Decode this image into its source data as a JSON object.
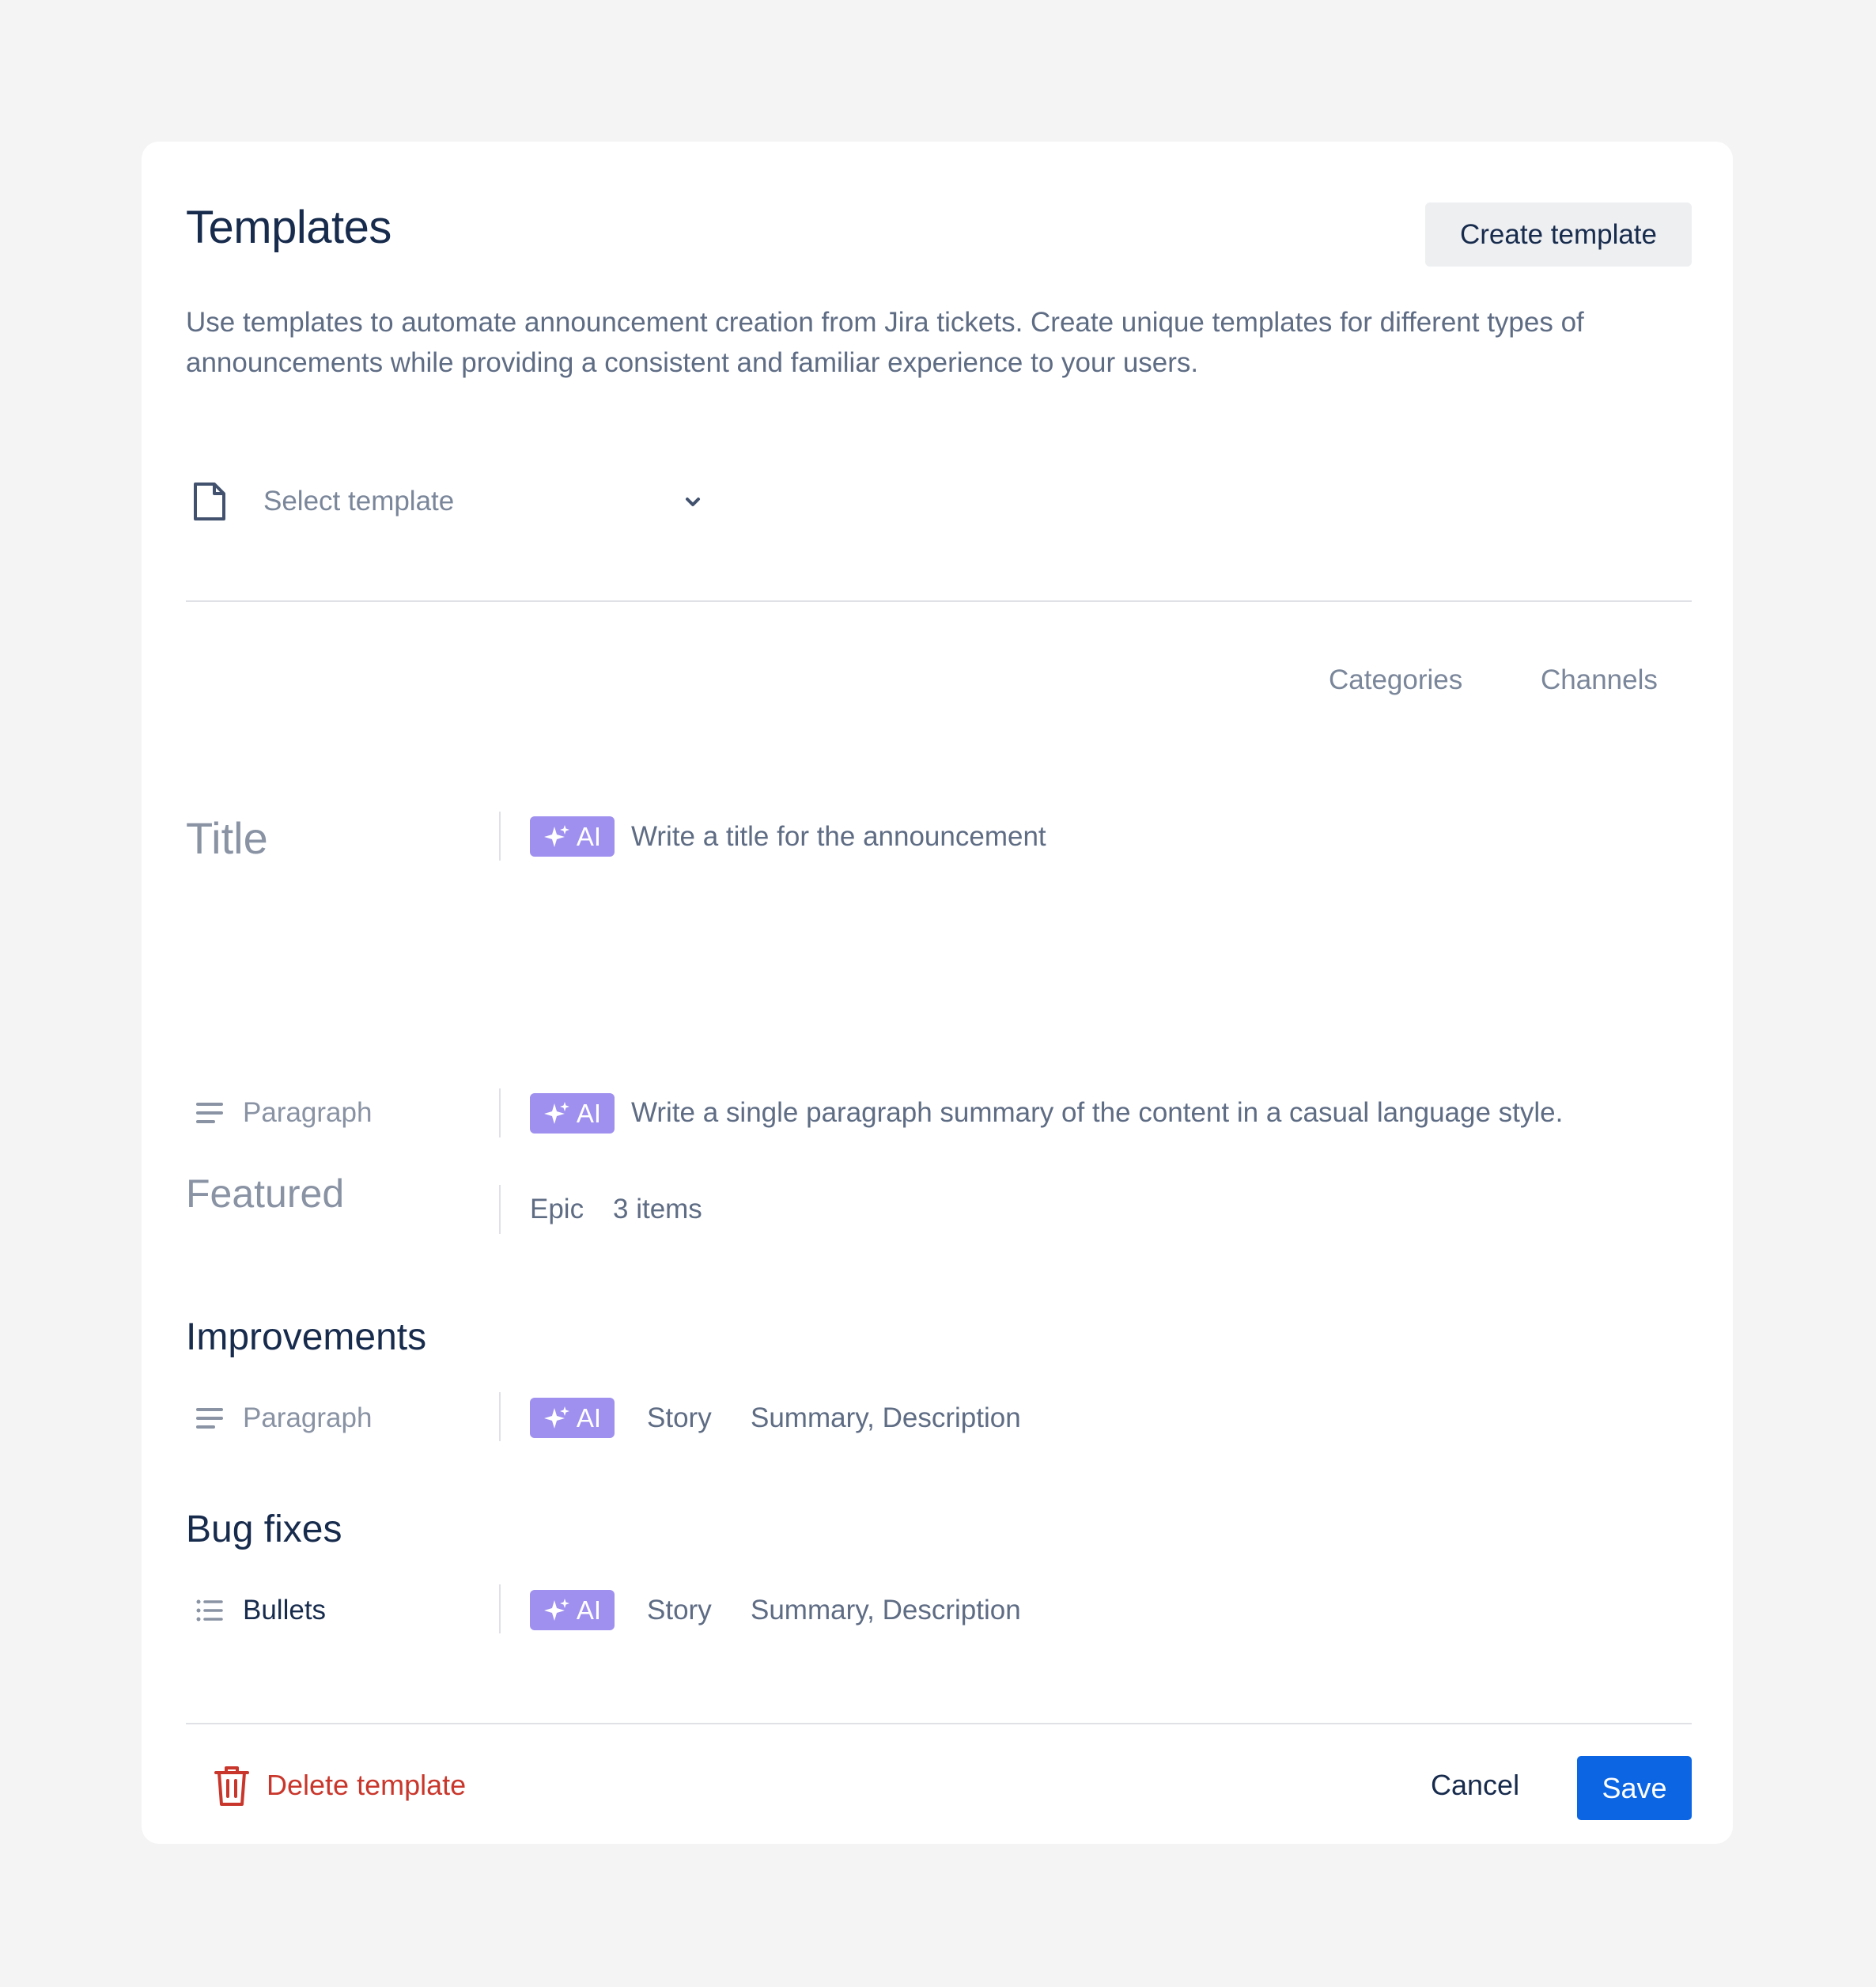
{
  "header": {
    "title": "Templates",
    "create_button": "Create template",
    "description": "Use templates to automate announcement creation from Jira tickets. Create unique templates for different types of announcements while providing a consistent and familiar experience to your users."
  },
  "template_select": {
    "icon": "file-icon",
    "placeholder": "Select template"
  },
  "tabs": [
    "Categories",
    "Channels"
  ],
  "ai_badge_label": "AI",
  "rows": {
    "title": {
      "label": "Title",
      "prompt": "Write a title for the announcement"
    },
    "intro": {
      "label": "Paragraph",
      "prompt": "Write a single paragraph summary of the content in a casual language style."
    },
    "featured": {
      "label": "Featured",
      "issue_type": "Epic",
      "count": "3 items"
    }
  },
  "sections": [
    {
      "title": "Improvements",
      "format": "Paragraph",
      "issue_type": "Story",
      "fields": "Summary, Description"
    },
    {
      "title": "Bug fixes",
      "format": "Bullets",
      "issue_type": "Story",
      "fields": "Summary, Description"
    }
  ],
  "footer": {
    "delete_label": "Delete template",
    "cancel_label": "Cancel",
    "save_label": "Save"
  },
  "colors": {
    "primary": "#0c66e4",
    "danger": "#c9372c",
    "ai_badge": "#9f8fef",
    "background": "#f4f4f5"
  }
}
